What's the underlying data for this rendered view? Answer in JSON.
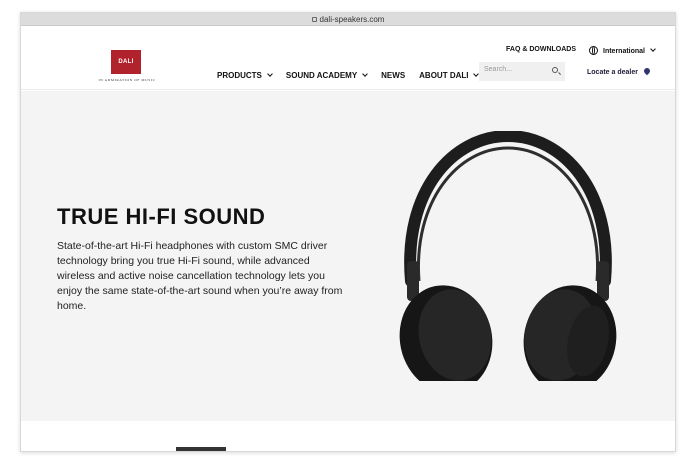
{
  "browser": {
    "url": "dali-speakers.com"
  },
  "brand": {
    "logo_text": "DALI",
    "tagline": "IN ADMIRATION OF MUSIC",
    "brand_color": "#b0222c"
  },
  "utility": {
    "faq": "FAQ & DOWNLOADS",
    "international": "International"
  },
  "nav": {
    "items": [
      {
        "label": "PRODUCTS",
        "dropdown": true
      },
      {
        "label": "SOUND ACADEMY",
        "dropdown": true
      },
      {
        "label": "NEWS",
        "dropdown": false
      },
      {
        "label": "ABOUT DALI",
        "dropdown": true
      }
    ]
  },
  "search": {
    "placeholder": "Search..."
  },
  "dealer": {
    "label": "Locate a dealer"
  },
  "hero": {
    "title": "TRUE HI-FI SOUND",
    "body": "State-of-the-art Hi-Fi headphones with custom SMC driver technology bring you true Hi-Fi sound, while advanced wireless and active noise cancellation technology lets you enjoy the same state-of-the-art sound when you’re away from home."
  }
}
